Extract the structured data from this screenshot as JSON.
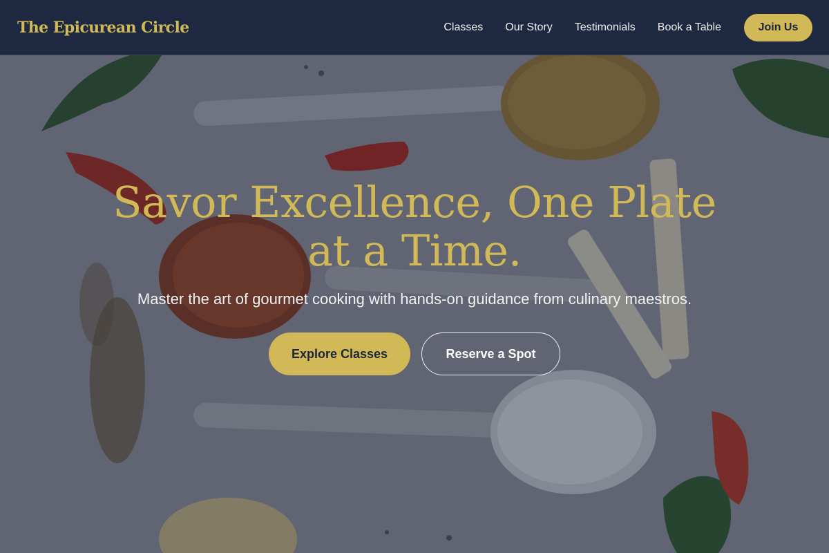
{
  "header": {
    "brand": "The Epicurean Circle",
    "nav": [
      {
        "label": "Classes"
      },
      {
        "label": "Our Story"
      },
      {
        "label": "Testimonials"
      },
      {
        "label": "Book a Table"
      }
    ],
    "cta_label": "Join Us"
  },
  "hero": {
    "title": "Savor Excellence, One Plate at a Time.",
    "subtitle": "Master the art of gourmet cooking with hands-on guidance from culinary maestros.",
    "primary_button": "Explore Classes",
    "secondary_button": "Reserve a Spot"
  },
  "colors": {
    "header_bg": "#1e2840",
    "accent_gold": "#d1b957",
    "overlay": "#1c2436",
    "text_light": "#f2f2f2"
  }
}
